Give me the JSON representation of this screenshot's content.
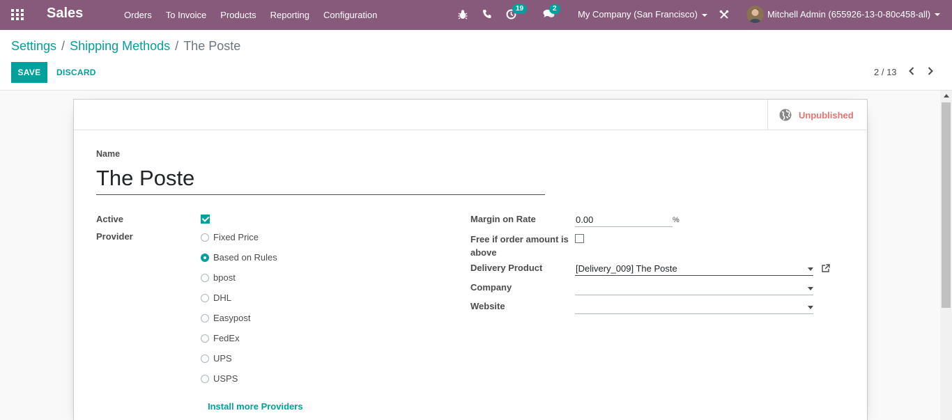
{
  "navbar": {
    "app_name": "Sales",
    "menu": [
      "Orders",
      "To Invoice",
      "Products",
      "Reporting",
      "Configuration"
    ],
    "activity_count": "19",
    "messages_count": "2",
    "company": "My Company (San Francisco)",
    "user": "Mitchell Admin (655926-13-0-80c458-all)",
    "accent_color": "#875a7b"
  },
  "breadcrumb": {
    "items": [
      "Settings",
      "Shipping Methods"
    ],
    "current": "The Poste"
  },
  "toolbar": {
    "save_label": "SAVE",
    "discard_label": "DISCARD"
  },
  "pager": {
    "value": "2 / 13"
  },
  "form": {
    "publish_status": "Unpublished",
    "name_label": "Name",
    "name_value": "The Poste",
    "active_label": "Active",
    "active_checked": true,
    "provider_label": "Provider",
    "providers": [
      "Fixed Price",
      "Based on Rules",
      "bpost",
      "DHL",
      "Easypost",
      "FedEx",
      "UPS",
      "USPS"
    ],
    "selected_provider": "Based on Rules",
    "install_link": "Install more Providers",
    "margin_label": "Margin on Rate",
    "margin_value": "0.00",
    "margin_unit": "%",
    "free_label_line1": "Free if order amount is",
    "free_label_line2": "above",
    "free_checked": false,
    "delivery_product_label": "Delivery Product",
    "delivery_product_value": "[Delivery_009] The Poste",
    "company_label": "Company",
    "company_value": "",
    "website_label": "Website",
    "website_value": ""
  }
}
